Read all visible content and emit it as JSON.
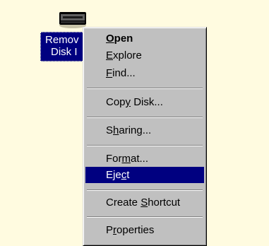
{
  "drive": {
    "icon": "removable-disk-icon",
    "label_line1": "Remov",
    "label_line2": "Disk I"
  },
  "menu": {
    "items": [
      {
        "pre": "",
        "acc": "O",
        "post": "pen"
      },
      {
        "pre": "",
        "acc": "E",
        "post": "xplore"
      },
      {
        "pre": "",
        "acc": "F",
        "post": "ind..."
      },
      {
        "pre": "Cop",
        "acc": "y",
        "post": " Disk..."
      },
      {
        "pre": "S",
        "acc": "h",
        "post": "aring..."
      },
      {
        "pre": "For",
        "acc": "m",
        "post": "at..."
      },
      {
        "pre": "Eje",
        "acc": "c",
        "post": "t"
      },
      {
        "pre": "Create ",
        "acc": "S",
        "post": "hortcut"
      },
      {
        "pre": "P",
        "acc": "r",
        "post": "operties"
      }
    ],
    "default_item": "Open",
    "selected_item": "Eject"
  },
  "colors": {
    "desktop": "#fffbe0",
    "menu_face": "#c0c0c0",
    "highlight": "#000080",
    "highlight_text": "#ffffff"
  }
}
